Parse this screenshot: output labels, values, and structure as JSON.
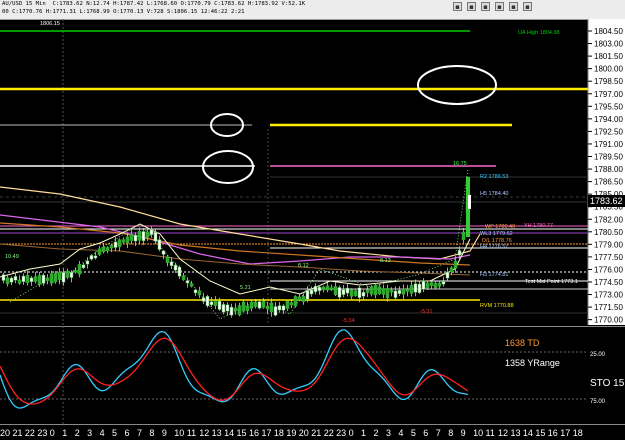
{
  "header": {
    "line1": "AU/USD 15 Min  C:1783.62 N:12.74 H:1787.42 L:1768.60 O:1770.79 C:1783.62 H:1783.92 V:52.1K",
    "line2": "00 C:1770.76 H:1771.31 L:1768.99 O:1770.13 V:728 S:1806.15 12:46:22 2:21"
  },
  "price_axis": {
    "ticks": [
      "1804.50",
      "1803.00",
      "1801.50",
      "1800.00",
      "1798.50",
      "1797.00",
      "1795.50",
      "1794.00",
      "1792.50",
      "1791.00",
      "1789.50",
      "1788.00",
      "1786.50",
      "1785.00",
      "1783.50",
      "1782.00",
      "1780.50",
      "1779.00",
      "1777.50",
      "1776.00",
      "1774.50",
      "1773.00",
      "1771.50",
      "1770.00"
    ],
    "last_price": "1783.62"
  },
  "chart_labels": {
    "top_value": "1806.15",
    "level_ua_high": "UA High 1804.38",
    "peak_value": "16.75",
    "r2": "R2 1786.53",
    "h5": "H5 1784.40",
    "yh": "YH 1780.77",
    "wp": "WP 1780.40",
    "wl3": "WL3 1779.62",
    "dl": "D/L 1778.76",
    "h4": "H4 1776.57",
    "h3": "H3 1774.81",
    "test_mid": "Test Mid Point 1773.1",
    "rvm": "RVM 1770.88",
    "l1": "10.49",
    "l2": "8.12",
    "l3": "5.21",
    "l4": "8.13",
    "l5": "-5.34",
    "l6": "-5.31"
  },
  "oscillator": {
    "td_label": "1638 TD",
    "range_label": "1358 YRange",
    "sto_label": "STO  15",
    "level_25": "25.00",
    "level_75": "75.00"
  },
  "time_axis": {
    "labels": [
      "20",
      "21",
      "22",
      "23",
      "0",
      "1",
      "2",
      "3",
      "4",
      "5",
      "6",
      "7",
      "8",
      "9",
      "10",
      "11",
      "12",
      "13",
      "14",
      "15",
      "16",
      "17",
      "18",
      "19",
      "20",
      "21",
      "22",
      "23",
      "0",
      "1",
      "2",
      "3",
      "4",
      "5",
      "6",
      "7",
      "8",
      "9",
      "10",
      "11",
      "12",
      "13",
      "14",
      "15",
      "16",
      "17",
      "18"
    ]
  },
  "colors": {
    "green_line": "#00cc00",
    "yellow_line": "#ffee00",
    "pink_line": "#ff66cc",
    "cyan": "#33ccff",
    "red": "#ff2222",
    "orange_label": "#ff9933"
  }
}
